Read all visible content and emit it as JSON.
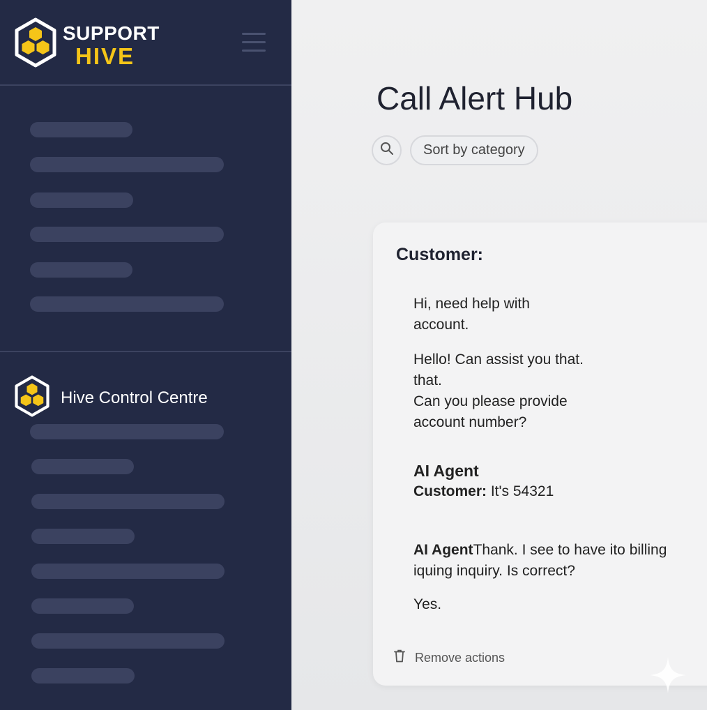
{
  "brand": {
    "line1": "SUPPORT",
    "line2": "HIVE"
  },
  "sidebar": {
    "section2_title": "Hive Control Centre"
  },
  "main": {
    "title": "Call Alert Hub",
    "sort_label": "Sort by category"
  },
  "chat": {
    "title": "Customer:",
    "message_1": "Hi, need help with account.",
    "message_2_line1": "Hello! Can assist you that. that.",
    "message_2_line2": "Can you please provide account number?",
    "message_3_speaker": "AI Agent",
    "message_3_label": "Customer:",
    "message_3_text": " It's 54321",
    "message_4_speaker": "AI Agent",
    "message_4_text": "Thank. I see to have ito billing iquing inquiry. Is correct?",
    "message_5": "Yes.",
    "remove_label": "Remove actions"
  },
  "colors": {
    "sidebar_bg": "#232a45",
    "brand_accent": "#f5c518",
    "skeleton": "#3b4260"
  },
  "icons": [
    "hive-logo-icon",
    "hamburger-menu-icon",
    "search-icon",
    "trash-icon",
    "sparkle-icon"
  ]
}
